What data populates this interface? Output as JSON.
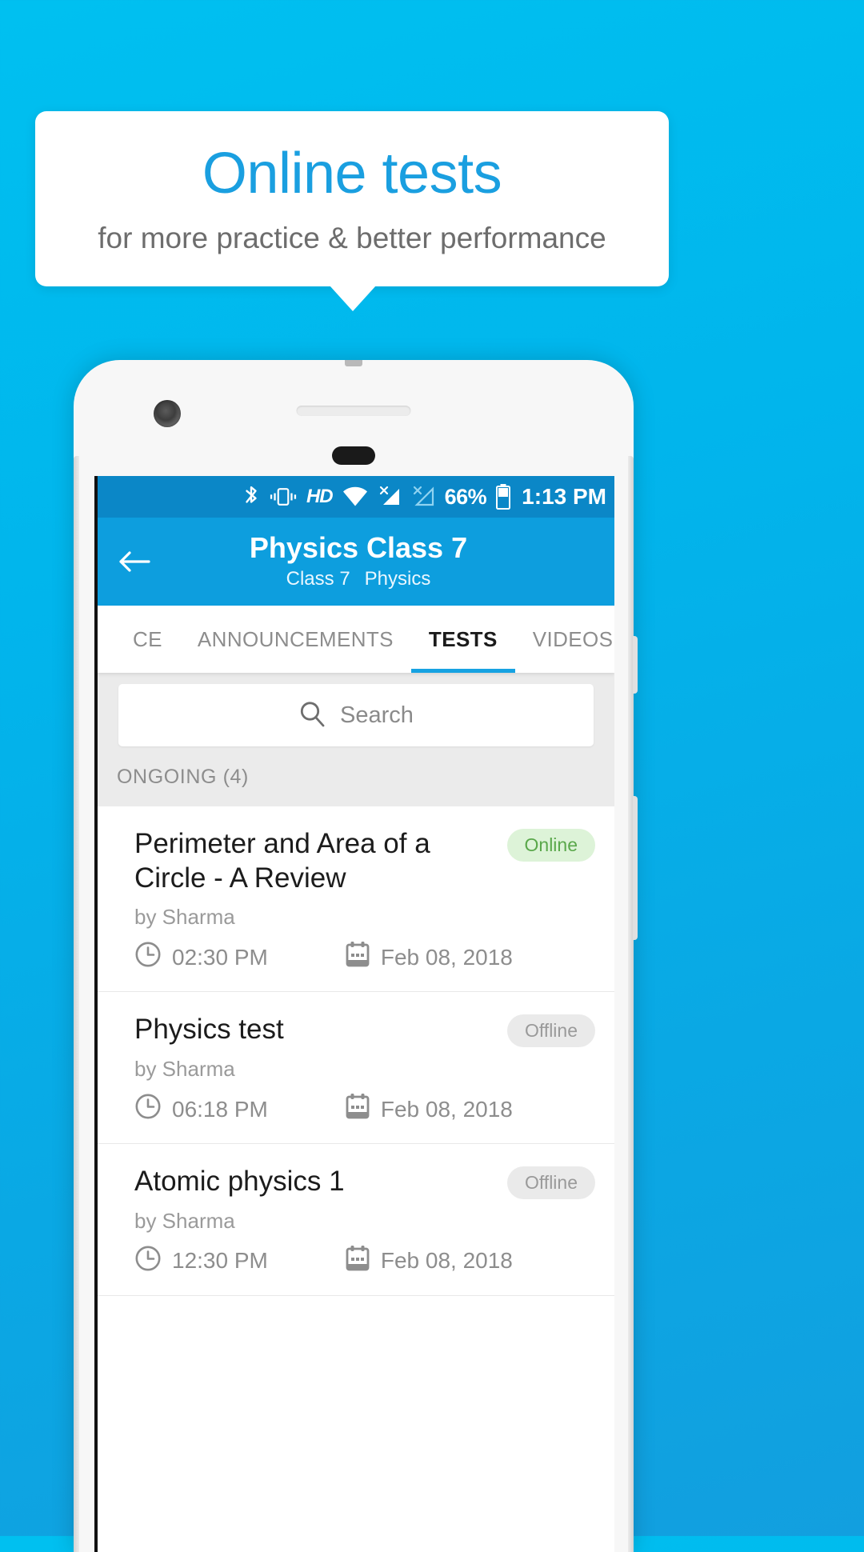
{
  "promo": {
    "title": "Online tests",
    "subtitle": "for more practice & better performance",
    "title_color": "#1a9fe0",
    "subtitle_color": "#6d6d6d",
    "background_color": "#00b8ef"
  },
  "status_bar": {
    "bluetooth_icon": "bluetooth-icon",
    "vibrate_icon": "vibrate-icon",
    "hd_label": "HD",
    "wifi_icon": "wifi-icon",
    "signal1_icon": "signal-no-sim-icon",
    "signal2_icon": "signal-empty-icon",
    "battery_percent": "66%",
    "battery_icon": "battery-icon",
    "time": "1:13 PM",
    "background_color": "#0b87c7"
  },
  "appbar": {
    "back_icon": "back-arrow-icon",
    "title": "Physics Class 7",
    "subtitle_class": "Class 7",
    "subtitle_subject": "Physics",
    "background_color": "#0d9ede"
  },
  "tabs": [
    {
      "label": "CE",
      "active": false
    },
    {
      "label": "ANNOUNCEMENTS",
      "active": false
    },
    {
      "label": "TESTS",
      "active": true
    },
    {
      "label": "VIDEOS",
      "active": false
    }
  ],
  "tabs_indicator_color": "#16a2e2",
  "search": {
    "icon": "search-icon",
    "placeholder": "Search",
    "value": ""
  },
  "section": {
    "label": "ONGOING (4)"
  },
  "tests": [
    {
      "title": "Perimeter and Area of a Circle - A Review",
      "author": "by Sharma",
      "time": "02:30 PM",
      "date": "Feb 08, 2018",
      "status": "Online",
      "status_type": "online",
      "clock_icon": "clock-icon",
      "calendar_icon": "calendar-icon"
    },
    {
      "title": "Physics test",
      "author": "by Sharma",
      "time": "06:18 PM",
      "date": "Feb 08, 2018",
      "status": "Offline",
      "status_type": "offline",
      "clock_icon": "clock-icon",
      "calendar_icon": "calendar-icon"
    },
    {
      "title": "Atomic physics 1",
      "author": "by Sharma",
      "time": "12:30 PM",
      "date": "Feb 08, 2018",
      "status": "Offline",
      "status_type": "offline",
      "clock_icon": "clock-icon",
      "calendar_icon": "calendar-icon"
    }
  ],
  "badge_colors": {
    "online_bg": "#ddf3d8",
    "online_fg": "#5aa84b",
    "offline_bg": "#eaeaea",
    "offline_fg": "#9a9a9a"
  }
}
